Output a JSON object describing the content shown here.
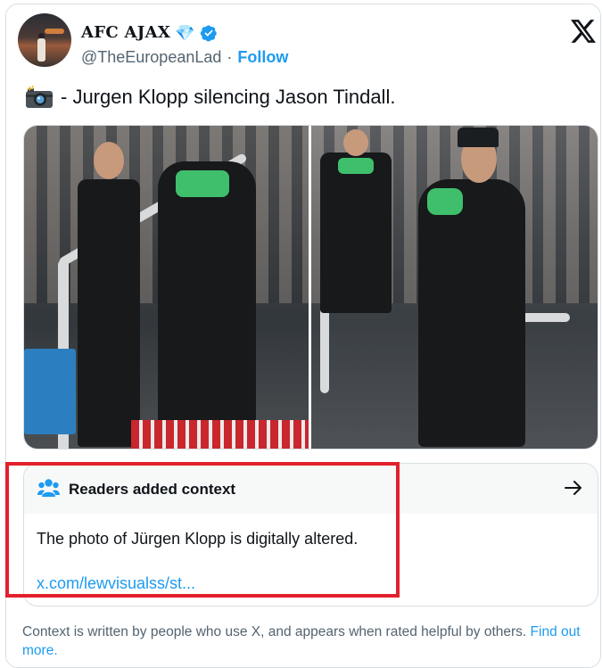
{
  "author": {
    "display_name": "AFC AJAX",
    "diamond": "💎",
    "handle": "@TheEuropeanLad",
    "separator": "·",
    "follow_label": "Follow"
  },
  "tweet": {
    "text": "- Jurgen Klopp silencing Jason Tindall."
  },
  "community_note": {
    "title": "Readers added context",
    "body": "The photo of Jürgen Klopp is digitally altered.",
    "link_text": "x.com/lewvisualss/st..."
  },
  "footnote": {
    "text": "Context is written by people who use X, and appears when rated helpful by others.",
    "link_text": "Find out more."
  },
  "colors": {
    "accent": "#1d9bf0",
    "verified": "#1d9bf0",
    "highlight_box": "#e3202d",
    "muted": "#536471"
  },
  "icons": [
    "verified-badge-icon",
    "x-logo-icon",
    "camera-icon",
    "people-icon",
    "arrow-right-icon"
  ]
}
